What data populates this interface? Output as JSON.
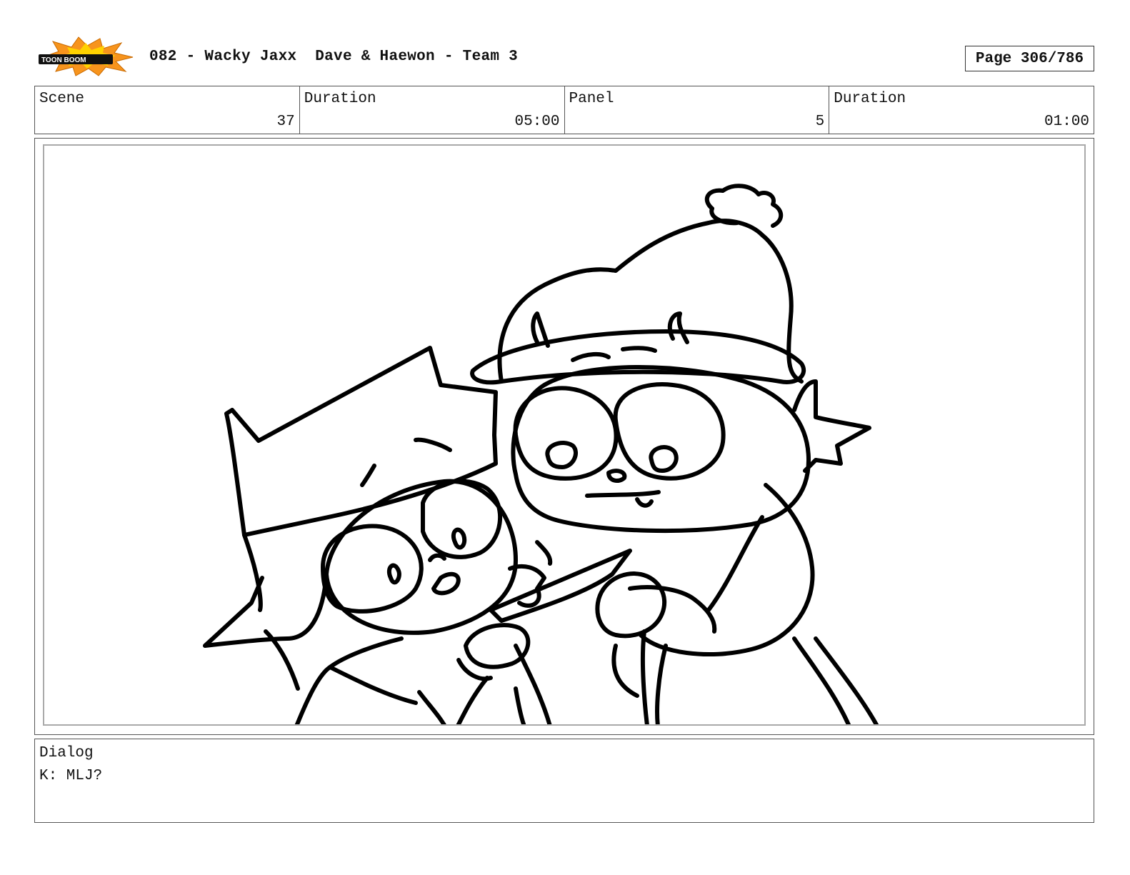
{
  "header": {
    "logo_text": "TOON BOOM",
    "title": "082 - Wacky Jaxx  Dave & Haewon - Team 3",
    "page": "Page 306/786"
  },
  "info": {
    "scene_label": "Scene",
    "scene_value": "37",
    "scene_duration_label": "Duration",
    "scene_duration_value": "05:00",
    "panel_label": "Panel",
    "panel_value": "5",
    "panel_duration_label": "Duration",
    "panel_duration_value": "01:00"
  },
  "dialog": {
    "label": "Dialog",
    "text": "K: MLJ?"
  },
  "colors": {
    "logo_orange": "#f7941d",
    "logo_yellow": "#ffd200",
    "ink": "#000000"
  }
}
